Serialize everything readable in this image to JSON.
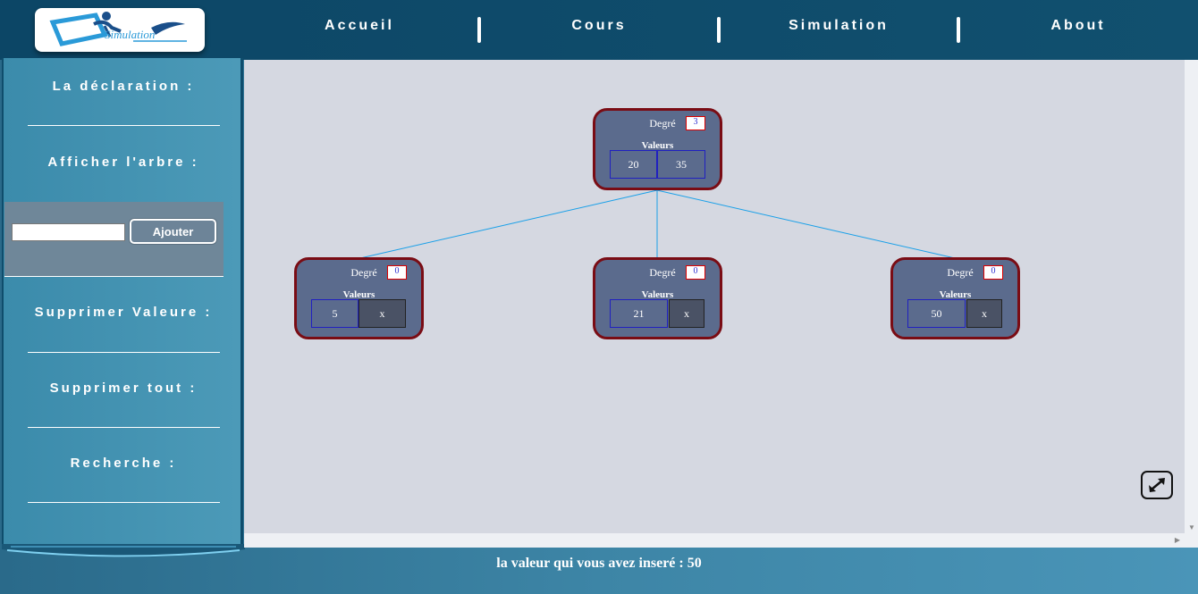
{
  "header": {
    "logo_text": "Simulation",
    "nav": [
      {
        "label": "Accueil"
      },
      {
        "label": "Cours"
      },
      {
        "label": "Simulation"
      },
      {
        "label": "About"
      }
    ]
  },
  "sidebar": {
    "declaration_label": "La déclaration :",
    "afficher_label": "Afficher l'arbre :",
    "add_input_value": "",
    "add_button_label": "Ajouter",
    "supprimer_valeur_label": "Supprimer Valeure :",
    "supprimer_tout_label": "Supprimer tout :",
    "recherche_label": "Recherche :"
  },
  "tree": {
    "degre_label": "Degré",
    "valeurs_label": "Valeurs",
    "nodes": [
      {
        "degre": "3",
        "values": [
          "20",
          "35"
        ]
      },
      {
        "degre": "0",
        "values": [
          "5",
          "x"
        ]
      },
      {
        "degre": "0",
        "values": [
          "21",
          "x"
        ]
      },
      {
        "degre": "0",
        "values": [
          "50",
          "x"
        ]
      }
    ]
  },
  "colors": {
    "header_bg": "#0c4666",
    "node_fill": "#5b6b8d",
    "node_border": "#7a0c14",
    "edge": "#1aa0e8",
    "canvas_bg": "#d5d8e1"
  },
  "icons": {
    "fullscreen": "expand-arrows-icon"
  },
  "status": {
    "text": "la valeur qui vous avez inseré : 50"
  }
}
